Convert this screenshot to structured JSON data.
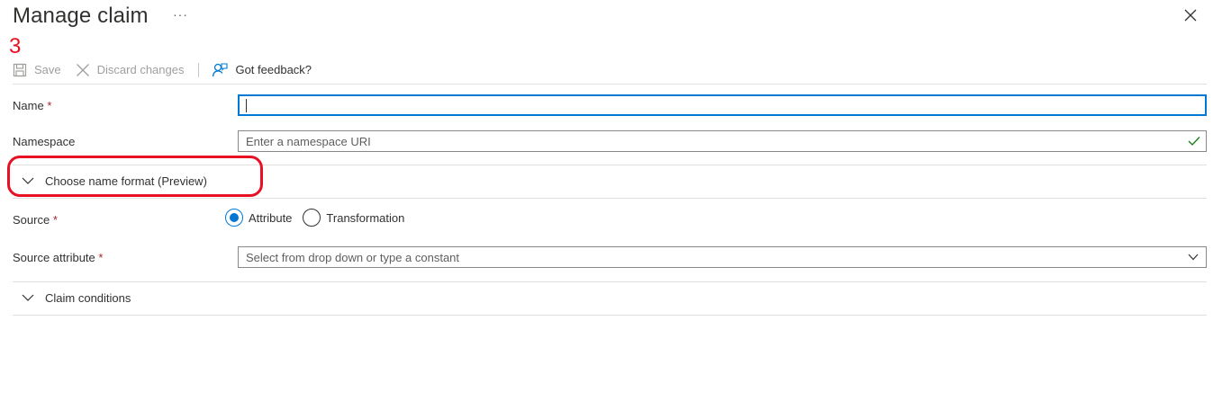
{
  "header": {
    "title": "Manage claim",
    "more_label": "···",
    "step_annotation": "3"
  },
  "toolbar": {
    "save_label": "Save",
    "discard_label": "Discard changes",
    "feedback_label": "Got feedback?"
  },
  "form": {
    "name": {
      "label": "Name",
      "required_mark": "*",
      "value": ""
    },
    "namespace": {
      "label": "Namespace",
      "placeholder": "Enter a namespace URI"
    },
    "name_format": {
      "label": "Choose name format (Preview)"
    },
    "source": {
      "label": "Source",
      "required_mark": "*",
      "options": [
        "Attribute",
        "Transformation"
      ],
      "selected": "Attribute"
    },
    "source_attribute": {
      "label": "Source attribute",
      "required_mark": "*",
      "placeholder": "Select from drop down or type a constant"
    },
    "claim_conditions": {
      "label": "Claim conditions"
    }
  },
  "colors": {
    "accent": "#0078d4",
    "required": "#a4262c",
    "annotation": "#e81123",
    "valid": "#107c10"
  }
}
